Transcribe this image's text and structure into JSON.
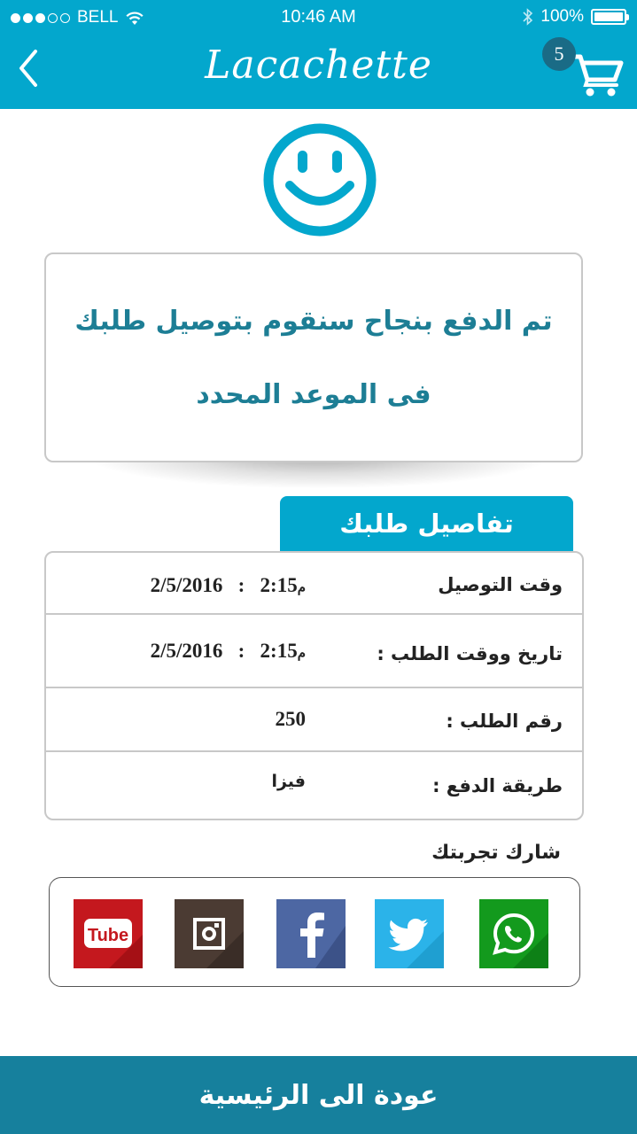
{
  "status_bar": {
    "carrier": "BELL",
    "time": "10:46 AM",
    "battery": "100%",
    "battery_level": 1.0,
    "signal_bars": 3
  },
  "header": {
    "title": "Lacachette",
    "cart_count": "5",
    "back_icon": "chevron-left-icon",
    "cart_icon": "shopping-cart-icon"
  },
  "message": {
    "line1": "تم الدفع بنجاح سنقوم بتوصيل طلبك",
    "line2": "فى الموعد المحدد"
  },
  "details": {
    "tab_label": "تفاصيل طلبك",
    "rows": [
      {
        "label": "وقت التوصيل",
        "value": "2/5/2016   :   2:15",
        "suffix": "م"
      },
      {
        "label": "تاريخ ووقت الطلب :",
        "value": "2/5/2016   :   2:15",
        "suffix": "م"
      },
      {
        "label": "رقم الطلب  :",
        "value": "250",
        "suffix": ""
      },
      {
        "label": "طريقة الدفع :",
        "value": "فيزا",
        "suffix": ""
      }
    ]
  },
  "share": {
    "title": "شارك تجربتك",
    "youtube_text": "Tube",
    "networks": [
      "youtube",
      "instagram",
      "facebook",
      "twitter",
      "whatsapp"
    ]
  },
  "footer": {
    "button_label": "عودة الى الرئيسية"
  },
  "colors": {
    "primary": "#03a7cd",
    "footer": "#16809d",
    "message_text": "#1d7e95",
    "youtube": "#c4181e",
    "instagram": "#4b3b33",
    "facebook": "#4d67a3",
    "twitter": "#2bb3e9",
    "whatsapp": "#139a1d"
  }
}
